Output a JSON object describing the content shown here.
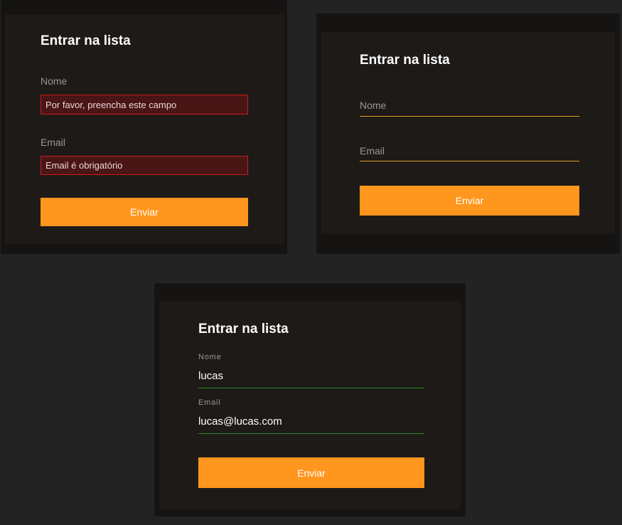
{
  "form_error": {
    "title": "Entrar na lista",
    "name_label": "Nome",
    "name_error": "Por favor, preencha este campo",
    "email_label": "Email",
    "email_error": "Email é obrigatório",
    "submit_label": "Enviar"
  },
  "form_empty": {
    "title": "Entrar na lista",
    "name_placeholder": "Nome",
    "email_placeholder": "Email",
    "submit_label": "Enviar"
  },
  "form_filled": {
    "title": "Entrar na lista",
    "name_label": "Nome",
    "name_value": "lucas",
    "email_label": "Email",
    "email_value": "lucas@lucas.com",
    "submit_label": "Enviar"
  },
  "colors": {
    "background": "#232323",
    "card_outer": "#161412",
    "card_inner": "#1d1a18",
    "accent": "#ff961e",
    "error_border": "#cc1c1c",
    "error_fill": "#4a1515",
    "valid_underline": "#2a8a2a",
    "input_underline": "#e39a24"
  }
}
